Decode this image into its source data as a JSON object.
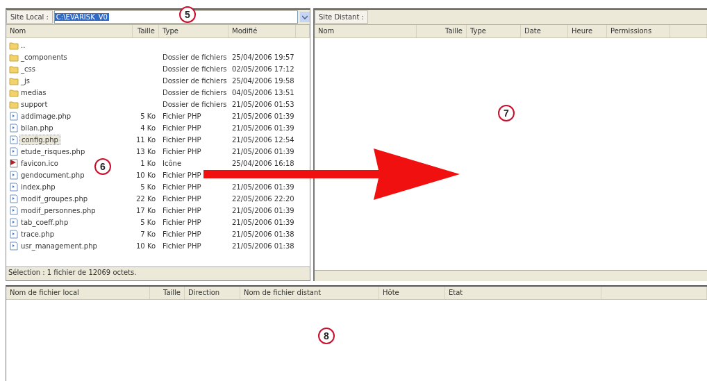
{
  "local_site": {
    "label": "Site Local :",
    "path": "C:\\EVARISK_V0",
    "columns": [
      "Nom",
      "Taille",
      "Type",
      "Modifié"
    ],
    "files": [
      {
        "kind": "folder",
        "name": "..",
        "selected": false
      },
      {
        "kind": "folder",
        "name": "_components",
        "type": "Dossier de fichiers",
        "modified": "25/04/2006 19:57",
        "selected": false
      },
      {
        "kind": "folder",
        "name": "_css",
        "type": "Dossier de fichiers",
        "modified": "02/05/2006 17:12",
        "selected": false
      },
      {
        "kind": "folder",
        "name": "_js",
        "type": "Dossier de fichiers",
        "modified": "25/04/2006 19:58",
        "selected": false
      },
      {
        "kind": "folder",
        "name": "medias",
        "type": "Dossier de fichiers",
        "modified": "04/05/2006 13:51",
        "selected": false
      },
      {
        "kind": "folder",
        "name": "support",
        "type": "Dossier de fichiers",
        "modified": "21/05/2006 01:53",
        "selected": false
      },
      {
        "kind": "php",
        "name": "addimage.php",
        "size": "5 Ko",
        "type": "Fichier PHP",
        "modified": "21/05/2006 01:39",
        "selected": false
      },
      {
        "kind": "php",
        "name": "bilan.php",
        "size": "4 Ko",
        "type": "Fichier PHP",
        "modified": "21/05/2006 01:39",
        "selected": false
      },
      {
        "kind": "php",
        "name": "config.php",
        "size": "11 Ko",
        "type": "Fichier PHP",
        "modified": "21/05/2006 12:54",
        "selected": true
      },
      {
        "kind": "php",
        "name": "etude_risques.php",
        "size": "13 Ko",
        "type": "Fichier PHP",
        "modified": "21/05/2006 01:39",
        "selected": false
      },
      {
        "kind": "ico",
        "name": "favicon.ico",
        "size": "1 Ko",
        "type": "Icône",
        "modified": "25/04/2006 16:18",
        "selected": false
      },
      {
        "kind": "php",
        "name": "gendocument.php",
        "size": "10 Ko",
        "type": "Fichier PHP",
        "selected": false
      },
      {
        "kind": "php",
        "name": "index.php",
        "size": "5 Ko",
        "type": "Fichier PHP",
        "modified": "21/05/2006 01:39",
        "selected": false
      },
      {
        "kind": "php",
        "name": "modif_groupes.php",
        "size": "22 Ko",
        "type": "Fichier PHP",
        "modified": "22/05/2006 22:20",
        "selected": false
      },
      {
        "kind": "php",
        "name": "modif_personnes.php",
        "size": "17 Ko",
        "type": "Fichier PHP",
        "modified": "21/05/2006 01:39",
        "selected": false
      },
      {
        "kind": "php",
        "name": "tab_coeff.php",
        "size": "5 Ko",
        "type": "Fichier PHP",
        "modified": "21/05/2006 01:39",
        "selected": false
      },
      {
        "kind": "php",
        "name": "trace.php",
        "size": "7 Ko",
        "type": "Fichier PHP",
        "modified": "21/05/2006 01:38",
        "selected": false
      },
      {
        "kind": "php",
        "name": "usr_management.php",
        "size": "10 Ko",
        "type": "Fichier PHP",
        "modified": "21/05/2006 01:38",
        "selected": false
      }
    ],
    "status": "Sélection : 1 fichier de 12069 octets."
  },
  "remote_site": {
    "label": "Site Distant :",
    "columns": [
      "Nom",
      "Taille",
      "Type",
      "Date",
      "Heure",
      "Permissions"
    ]
  },
  "transfer_queue": {
    "columns": [
      "Nom de fichier local",
      "Taille",
      "Direction",
      "Nom de fichier distant",
      "Hôte",
      "Etat"
    ]
  },
  "callouts": [
    "5",
    "6",
    "7",
    "8"
  ]
}
